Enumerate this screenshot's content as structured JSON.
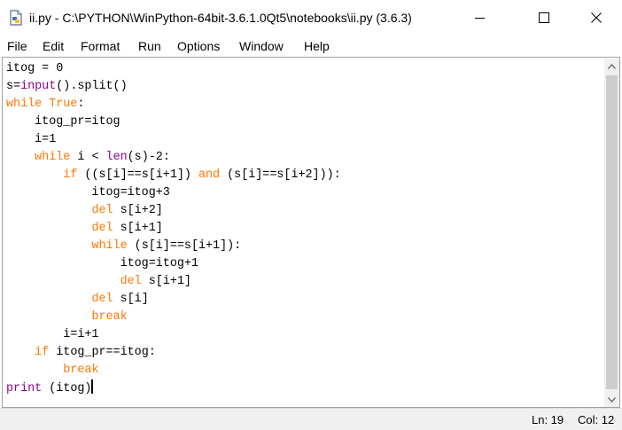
{
  "window": {
    "title": "ii.py - C:\\PYTHON\\WinPython-64bit-3.6.1.0Qt5\\notebooks\\ii.py (3.6.3)",
    "app_icon": "python-file-icon"
  },
  "menu": {
    "items": [
      {
        "label": "File"
      },
      {
        "label": "Edit"
      },
      {
        "label": "Format"
      },
      {
        "label": "Run"
      },
      {
        "label": "Options"
      },
      {
        "label": "Window"
      },
      {
        "label": "Help"
      }
    ]
  },
  "editor": {
    "lines": [
      [
        {
          "t": "itog = 0",
          "c": ""
        }
      ],
      [
        {
          "t": "s=",
          "c": ""
        },
        {
          "t": "input",
          "c": "bi"
        },
        {
          "t": "().split()",
          "c": ""
        }
      ],
      [
        {
          "t": "while",
          "c": "kw"
        },
        {
          "t": " ",
          "c": ""
        },
        {
          "t": "True",
          "c": "kw"
        },
        {
          "t": ":",
          "c": ""
        }
      ],
      [
        {
          "t": "    itog_pr=itog",
          "c": ""
        }
      ],
      [
        {
          "t": "    i=1",
          "c": ""
        }
      ],
      [
        {
          "t": "    ",
          "c": ""
        },
        {
          "t": "while",
          "c": "kw"
        },
        {
          "t": " i < ",
          "c": ""
        },
        {
          "t": "len",
          "c": "bi"
        },
        {
          "t": "(s)-2:",
          "c": ""
        }
      ],
      [
        {
          "t": "        ",
          "c": ""
        },
        {
          "t": "if",
          "c": "kw"
        },
        {
          "t": " ((s[i]==s[i+1]) ",
          "c": ""
        },
        {
          "t": "and",
          "c": "kw"
        },
        {
          "t": " (s[i]==s[i+2])):",
          "c": ""
        }
      ],
      [
        {
          "t": "            itog=itog+3",
          "c": ""
        }
      ],
      [
        {
          "t": "            ",
          "c": ""
        },
        {
          "t": "del",
          "c": "kw"
        },
        {
          "t": " s[i+2]",
          "c": ""
        }
      ],
      [
        {
          "t": "            ",
          "c": ""
        },
        {
          "t": "del",
          "c": "kw"
        },
        {
          "t": " s[i+1]",
          "c": ""
        }
      ],
      [
        {
          "t": "            ",
          "c": ""
        },
        {
          "t": "while",
          "c": "kw"
        },
        {
          "t": " (s[i]==s[i+1]):",
          "c": ""
        }
      ],
      [
        {
          "t": "                itog=itog+1",
          "c": ""
        }
      ],
      [
        {
          "t": "                ",
          "c": ""
        },
        {
          "t": "del",
          "c": "kw"
        },
        {
          "t": " s[i+1]",
          "c": ""
        }
      ],
      [
        {
          "t": "            ",
          "c": ""
        },
        {
          "t": "del",
          "c": "kw"
        },
        {
          "t": " s[i]",
          "c": ""
        }
      ],
      [
        {
          "t": "            ",
          "c": ""
        },
        {
          "t": "break",
          "c": "kw"
        }
      ],
      [
        {
          "t": "        i=i+1",
          "c": ""
        }
      ],
      [
        {
          "t": "    ",
          "c": ""
        },
        {
          "t": "if",
          "c": "kw"
        },
        {
          "t": " itog_pr==itog:",
          "c": ""
        }
      ],
      [
        {
          "t": "        ",
          "c": ""
        },
        {
          "t": "break",
          "c": "kw"
        }
      ],
      [
        {
          "t": "print",
          "c": "bi"
        },
        {
          "t": " (itog)",
          "c": ""
        }
      ]
    ],
    "colors": {
      "keyword": "#ff7700",
      "builtin": "#900090",
      "text": "#000000"
    }
  },
  "status": {
    "line": "Ln: 19",
    "col": "Col: 12"
  }
}
